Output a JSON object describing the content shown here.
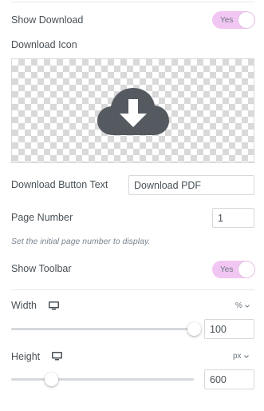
{
  "show_download": {
    "label": "Show Download",
    "toggle_text": "Yes"
  },
  "download_icon": {
    "label": "Download Icon",
    "icon": "cloud-download-icon"
  },
  "download_button_text": {
    "label": "Download Button Text",
    "value": "Download PDF"
  },
  "page_number": {
    "label": "Page Number",
    "value": "1",
    "hint": "Set the initial page number to display."
  },
  "show_toolbar": {
    "label": "Show Toolbar",
    "toggle_text": "Yes"
  },
  "width": {
    "label": "Width",
    "device_icon": "desktop-icon",
    "unit": "%",
    "value": "100",
    "slider_fraction": 1.0
  },
  "height": {
    "label": "Height",
    "device_icon": "desktop-icon",
    "unit": "px",
    "value": "600",
    "slider_fraction": 0.22
  },
  "colors": {
    "toggle_bg": "#f2c6f2",
    "icon_fill": "#555a61",
    "text": "#495157"
  }
}
